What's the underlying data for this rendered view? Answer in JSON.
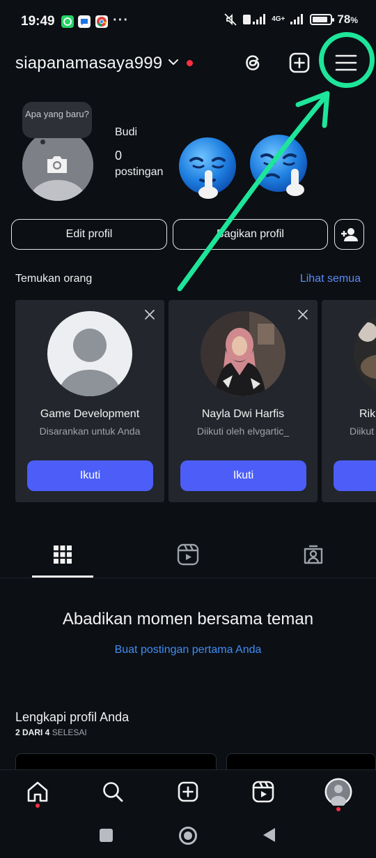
{
  "status_bar": {
    "time": "19:49",
    "dots": "···",
    "battery_pct": "78",
    "battery_unit": "%",
    "net_label": "4G+",
    "app_icons": [
      "whatsapp-icon",
      "messages-icon",
      "chrome-icon"
    ]
  },
  "header": {
    "username": "siapanamasaya999",
    "icons": [
      "threads-icon",
      "create-post-icon",
      "menu-icon"
    ]
  },
  "profile": {
    "note_text": "Apa yang baru?",
    "name": "Budi",
    "post_count": "0",
    "post_label": "postingan",
    "edit_button": "Edit profil",
    "share_button": "Bagikan profil"
  },
  "suggestions": {
    "title": "Temukan orang",
    "see_all": "Lihat semua",
    "cards": [
      {
        "name": "Game Development",
        "subtitle": "Disarankan untuk Anda",
        "button": "Ikuti"
      },
      {
        "name": "Nayla Dwi Harfis",
        "subtitle": "Diikuti oleh elvgartic_",
        "button": "Ikuti"
      },
      {
        "name": "Rik",
        "subtitle": "Diikut",
        "button": ""
      }
    ]
  },
  "tabs": [
    "grid-icon",
    "reels-icon",
    "tagged-icon"
  ],
  "empty_state": {
    "title": "Abadikan momen bersama teman",
    "link": "Buat postingan pertama Anda"
  },
  "complete_profile": {
    "title": "Lengkapi profil Anda",
    "progress_bold": "2 DARI 4",
    "progress_rest": " SELESAI",
    "progress_fraction": 0.5
  },
  "bottom_nav": [
    "home-icon",
    "search-icon",
    "create-icon",
    "reels-icon",
    "profile-avatar"
  ],
  "colors": {
    "background": "#0c0f14",
    "accent_blue": "#4c5ef7",
    "link_blue": "#5b8cf7",
    "notification_red": "#ff3040",
    "annotation_green": "#1ee59a"
  }
}
